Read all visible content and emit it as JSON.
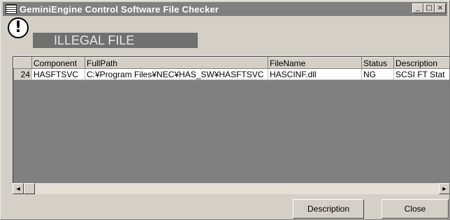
{
  "window": {
    "title": "GeminiEngine Control Software File Checker",
    "controls": {
      "minimize": "_",
      "maximize": "□",
      "close": "×"
    }
  },
  "alert": {
    "icon": "exclamation-icon",
    "glyph": "!",
    "status_text": "ILLEGAL FILE"
  },
  "table": {
    "columns": [
      "",
      "Component",
      "FullPath",
      "FileName",
      "Status",
      "Description"
    ],
    "rows": [
      {
        "num": "24",
        "component": "HASFTSVC",
        "fullpath": "C:¥Program Files¥NEC¥HAS_SW¥HASFTSVC",
        "filename": "HASCINF.dll",
        "status": "NG",
        "description": "SCSI FT Stat"
      }
    ]
  },
  "scrollbar": {
    "left_arrow": "◄",
    "right_arrow": "►"
  },
  "buttons": {
    "description": "Description",
    "close": "Close"
  }
}
